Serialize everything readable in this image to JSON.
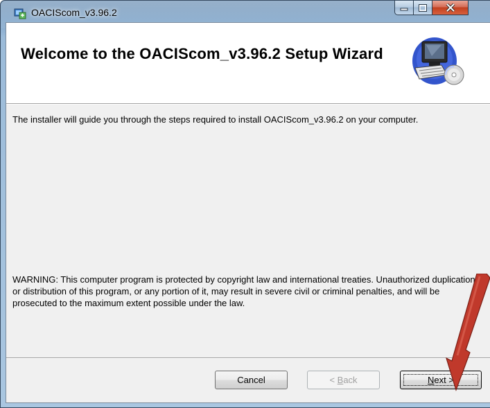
{
  "window": {
    "title": "OACIScom_v3.96.2",
    "minimize_glyph": "—",
    "maximize_glyph": "☐",
    "close_glyph": "X"
  },
  "banner": {
    "title": "Welcome to the OACIScom_v3.96.2 Setup Wizard",
    "icon": "computer-setup-icon"
  },
  "content": {
    "intro": "The installer will guide you through the steps required to install OACIScom_v3.96.2 on your computer.",
    "warning": "WARNING: This computer program is protected by copyright law and international treaties. Unauthorized duplication or distribution of this program, or any portion of it, may result in severe civil or criminal penalties, and will be prosecuted to the maximum extent possible under the law."
  },
  "buttons": {
    "cancel": "Cancel",
    "back_prefix": "< ",
    "back_mnemonic": "B",
    "back_rest": "ack",
    "next_mnemonic": "N",
    "next_rest": "ext >"
  },
  "colors": {
    "accent_arrow": "#c0392b",
    "titlebar": "#9bbbd9",
    "client_bg": "#f0f0f0"
  }
}
